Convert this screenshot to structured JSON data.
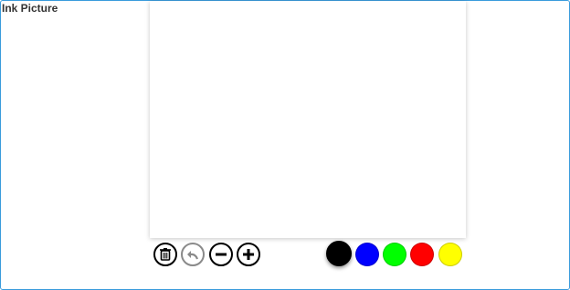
{
  "title": "Ink Picture",
  "toolbar": {
    "tools": [
      {
        "name": "delete",
        "icon": "trash-icon",
        "enabled": true
      },
      {
        "name": "undo",
        "icon": "undo-arrow-icon",
        "enabled": false
      },
      {
        "name": "thinner",
        "icon": "minus-icon",
        "enabled": true
      },
      {
        "name": "thicker",
        "icon": "plus-icon",
        "enabled": true
      }
    ],
    "colors": [
      {
        "name": "black",
        "hex": "#000000",
        "selected": true
      },
      {
        "name": "blue",
        "hex": "#0000ff",
        "selected": false
      },
      {
        "name": "green",
        "hex": "#00ff00",
        "selected": false
      },
      {
        "name": "red",
        "hex": "#ff0000",
        "selected": false
      },
      {
        "name": "yellow",
        "hex": "#ffff00",
        "selected": false
      }
    ]
  },
  "accent": "#3a9bdc"
}
